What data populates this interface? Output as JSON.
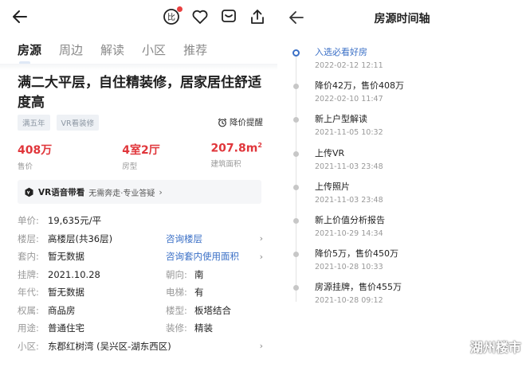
{
  "left": {
    "tabs": [
      {
        "label": "房源",
        "active": true
      },
      {
        "label": "周边"
      },
      {
        "label": "解读"
      },
      {
        "label": "小区"
      },
      {
        "label": "推荐"
      }
    ],
    "title": "满二大平层，自住精装修，居家居住舒适度高",
    "tags": [
      "满五年",
      "VR看装修"
    ],
    "price_alert": "降价提醒",
    "stats": [
      {
        "value": "408万",
        "label": "售价"
      },
      {
        "value": "4室2厅",
        "label": "房型"
      },
      {
        "value": "207.8m",
        "sup": "2",
        "label": "建筑面积"
      }
    ],
    "vr": {
      "title": "VR语音带看",
      "desc": "无需奔走·专业答疑"
    },
    "info": {
      "unit_price_k": "单价:",
      "unit_price_v": "19,635元/平",
      "floor_k": "楼层:",
      "floor_v": "高楼层(共36层)",
      "floor_link": "咨询楼层",
      "inner_k": "套内:",
      "inner_v": "暂无数据",
      "inner_link": "咨询套内使用面积",
      "listed_k": "挂牌:",
      "listed_v": "2021.10.28",
      "facing_k": "朝向:",
      "facing_v": "南",
      "year_k": "年代:",
      "year_v": "暂无数据",
      "elevator_k": "电梯:",
      "elevator_v": "有",
      "rights_k": "权属:",
      "rights_v": "商品房",
      "type_k": "楼型:",
      "type_v": "板塔结合",
      "use_k": "用途:",
      "use_v": "普通住宅",
      "decor_k": "装修:",
      "decor_v": "精装",
      "community_k": "小区:",
      "community_v": "东郡红树湾 (吴兴区-湖东西区)"
    }
  },
  "right": {
    "title": "房源时间轴",
    "timeline": [
      {
        "event": "入选必看好房",
        "time": "2022-02-12 12:11"
      },
      {
        "event": "降价42万，售价408万",
        "time": "2022-02-10 11:47"
      },
      {
        "event": "新上户型解读",
        "time": "2021-11-05 10:32"
      },
      {
        "event": "上传VR",
        "time": "2021-11-03 23:48"
      },
      {
        "event": "上传照片",
        "time": "2021-11-03 23:48"
      },
      {
        "event": "新上价值分析报告",
        "time": "2021-10-29 14:34"
      },
      {
        "event": "降价5万，售价450万",
        "time": "2021-10-28 10:33"
      },
      {
        "event": "房源挂牌，售价455万",
        "time": "2021-10-28 09:12"
      }
    ]
  },
  "watermark": "湖州楼市",
  "colors": {
    "accent_blue": "#3a6fc6",
    "price_red": "#e0363b",
    "alert_dot": "#e94040"
  }
}
